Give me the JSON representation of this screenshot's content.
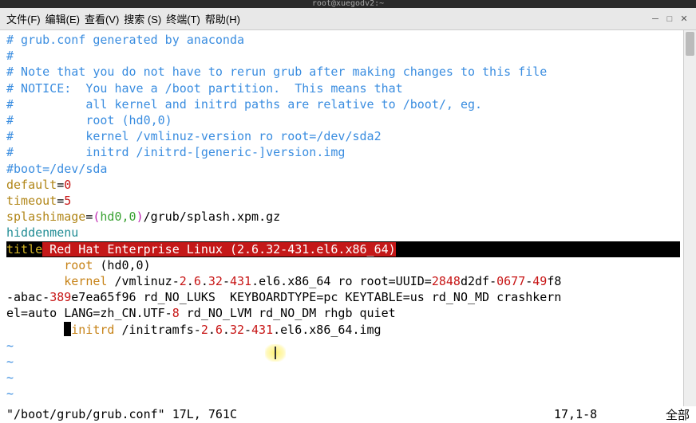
{
  "titlebar": {
    "text": "root@xuegodv2:~"
  },
  "menubar": {
    "items": [
      "文件(F)",
      "编辑(E)",
      "查看(V)",
      "搜索 (S)",
      "终端(T)",
      "帮助(H)"
    ]
  },
  "file": {
    "lines": {
      "l1_comment": "# grub.conf generated by anaconda",
      "l2_comment": "#",
      "l3_comment": "# Note that you do not have to rerun grub after making changes to this file",
      "l4_comment": "# NOTICE:  You have a /boot partition.  This means that",
      "l5_comment": "#          all kernel and initrd paths are relative to /boot/, eg.",
      "l6_comment": "#          root (hd0,0)",
      "l7_comment": "#          kernel /vmlinuz-version ro root=/dev/sda2",
      "l8_comment": "#          initrd /initrd-[generic-]version.img",
      "boot": "#boot=/dev/sda",
      "default_kw": "default",
      "default_val": "0",
      "timeout_kw": "timeout",
      "timeout_val": "5",
      "splash_kw": "splashimage",
      "splash_open": "(",
      "splash_hd": "hd0,0",
      "splash_close": ")",
      "splash_path": "/grub/splash.xpm.gz",
      "hiddenmenu": "hiddenmenu",
      "title_kw": "title",
      "title_name": " Red Hat Enterprise Linux (2.6.32-431.el6.x86_64)",
      "root_kw": "root",
      "root_val": " (hd0,0)",
      "kernel_kw": "kernel",
      "kernel_path_pre": " /vmlinuz-",
      "kernel_ver1": "2",
      "kernel_ver_dot1": ".",
      "kernel_ver2": "6",
      "kernel_ver_dot2": ".",
      "kernel_ver3": "32",
      "kernel_ver_dash": "-",
      "kernel_ver4": "431",
      "kernel_path_post": ".el6.x86_64 ro root=UUID=",
      "uuid1": "2848",
      "uuid_t1": "d2df-",
      "uuid2": "0677",
      "uuid_t2": "-",
      "uuid3": "49",
      "uuid_t3": "f8",
      "wrap1_pre": "-abac-",
      "wrap1_n1": "389",
      "wrap1_t1": "e7ea65f96 rd_NO_LUKS  KEYBOARDTYPE=pc KEYTABLE=us rd_NO_MD crashkern",
      "wrap2_t1": "el=auto LANG=zh_CN.UTF-",
      "wrap2_n1": "8",
      "wrap2_t2": " rd_NO_LVM rd_NO_DM rhgb quiet",
      "initrd_kw": "initrd",
      "initrd_pre": " /initramfs-",
      "initrd_v1": "2",
      "initrd_d1": ".",
      "initrd_v2": "6",
      "initrd_d2": ".",
      "initrd_v3": "32",
      "initrd_dash": "-",
      "initrd_v4": "431",
      "initrd_post": ".el6.x86_64.img"
    }
  },
  "status": {
    "filename": "\"/boot/grub/grub.conf\"",
    "fileinfo": " 17L, 761C",
    "position": "17,1-8",
    "percent": "全部"
  }
}
